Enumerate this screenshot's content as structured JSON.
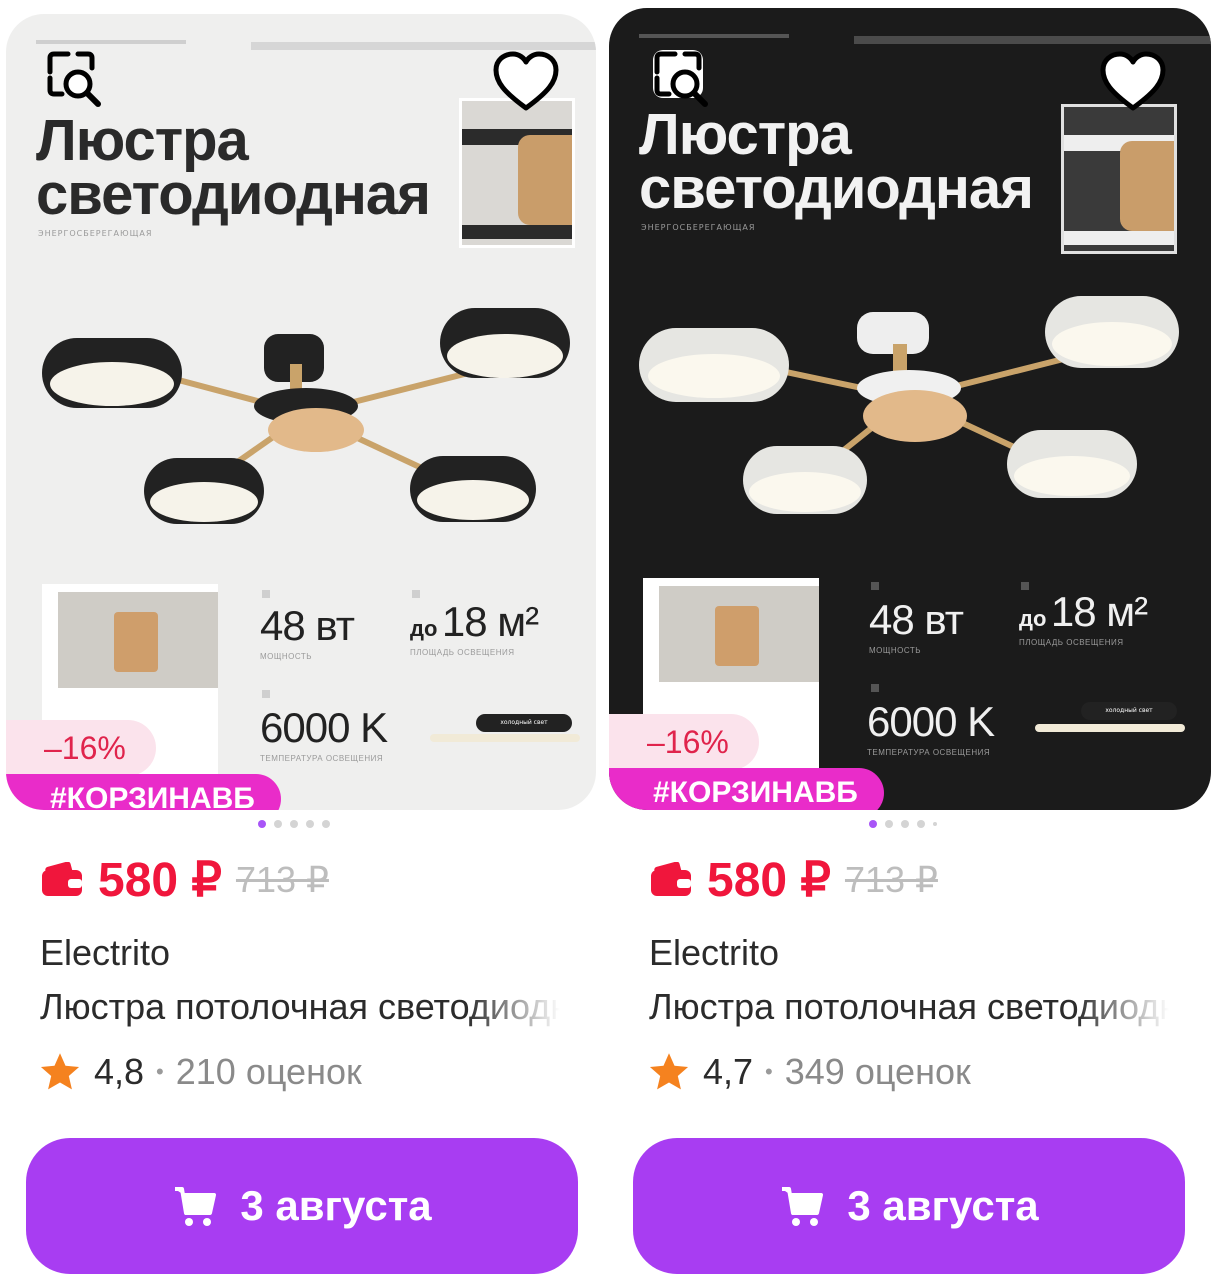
{
  "products": [
    {
      "theme": "light",
      "banner": {
        "title_line1": "Люстра",
        "title_line2": "светодиодная",
        "subtitle": "ЭНЕРГОСБЕРЕГАЮЩАЯ",
        "power_value": "48 вт",
        "power_caption": "МОЩНОСТЬ",
        "area_prefix": "до",
        "area_value": "18 м²",
        "area_caption": "ПЛОЩАДЬ ОСВЕЩЕНИЯ",
        "temp_value": "6000 K",
        "temp_caption": "ТЕМПЕРАТУРА ОСВЕЩЕНИЯ",
        "light_pill": "холодный свет"
      },
      "discount": "–16%",
      "tag": "#КОРЗИНАВБ",
      "price": "580 ₽",
      "old_price": "713 ₽",
      "brand": "Electrito",
      "name": "Люстра потолочная светодиодная",
      "rating": "4,8",
      "reviews": "210 оценок",
      "delivery": "3 августа",
      "pager": {
        "count": 5,
        "active": 0
      }
    },
    {
      "theme": "dark",
      "banner": {
        "title_line1": "Люстра",
        "title_line2": "светодиодная",
        "subtitle": "ЭНЕРГОСБЕРЕГАЮЩАЯ",
        "power_value": "48 вт",
        "power_caption": "МОЩНОСТЬ",
        "area_prefix": "до",
        "area_value": "18 м²",
        "area_caption": "ПЛОЩАДЬ ОСВЕЩЕНИЯ",
        "temp_value": "6000 K",
        "temp_caption": "ТЕМПЕРАТУРА ОСВЕЩЕНИЯ",
        "light_pill": "холодный свет"
      },
      "discount": "–16%",
      "tag": "#КОРЗИНАВБ",
      "price": "580 ₽",
      "old_price": "713 ₽",
      "brand": "Electrito",
      "name": "Люстра потолочная светодиодная",
      "rating": "4,7",
      "reviews": "349 оценок",
      "delivery": "3 августа",
      "pager": {
        "count": 5,
        "active": 0
      }
    }
  ],
  "icons": {
    "search": "image-search-icon",
    "favorite": "heart-icon",
    "wallet": "wallet-icon",
    "star": "star-icon",
    "cart": "cart-icon"
  },
  "colors": {
    "accent": "#a83df2",
    "price": "#f0163c",
    "tag": "#e92cc9",
    "star": "#f5821f",
    "discount_bg": "#fbe3ec"
  }
}
